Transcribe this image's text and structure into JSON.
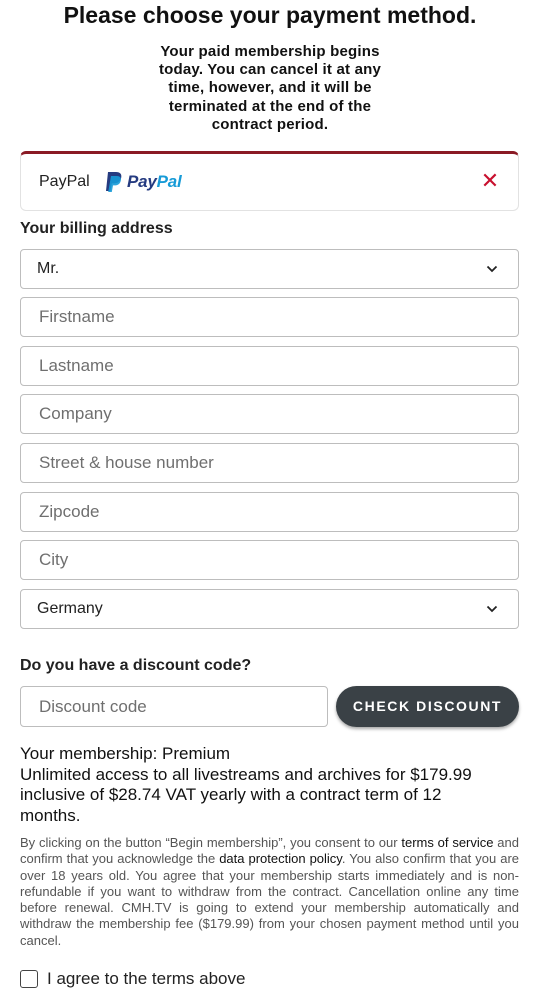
{
  "header": {
    "title": "Please choose your payment method.",
    "intro": "Your paid membership begins today. You can cancel it at any time, however, and it will be terminated at the end of the contract period."
  },
  "payment": {
    "method_label": "PayPal",
    "logo_pay": "Pay",
    "logo_pal": "Pal",
    "remove_icon": "close-icon",
    "remove_glyph": "✕",
    "accent_color": "#8a1a24",
    "remove_color": "#c8102e"
  },
  "billing": {
    "heading": "Your billing address",
    "salutation": "Mr.",
    "firstname_placeholder": "Firstname",
    "lastname_placeholder": "Lastname",
    "company_placeholder": "Company",
    "street_placeholder": "Street & house number",
    "zipcode_placeholder": "Zipcode",
    "city_placeholder": "City",
    "country": "Germany"
  },
  "discount": {
    "heading": "Do you have a discount code?",
    "placeholder": "Discount code",
    "button_label": "CHECK DISCOUNT"
  },
  "membership": {
    "plan": "Your membership: Premium",
    "description": "Unlimited access to all livestreams and archives for $179.99 inclusive of $28.74 VAT yearly with a contract term of 12 months."
  },
  "legal": {
    "part1": "By clicking on the button “Begin membership”, you consent to our ",
    "terms_link": "terms of service",
    "part2": " and confirm that you acknowledge the ",
    "privacy_link": "data protection policy",
    "part3": ". You also confirm that you are over 18 years old. You agree that your membership starts immediately and is non-refundable if you want to withdraw from the contract. Cancellation online any time before renewal. CMH.TV is going to extend your membership automatically and withdraw the membership fee ($179.99) from your chosen payment method until you cancel."
  },
  "agreement": {
    "label": "I agree to the terms above",
    "checked": false
  }
}
